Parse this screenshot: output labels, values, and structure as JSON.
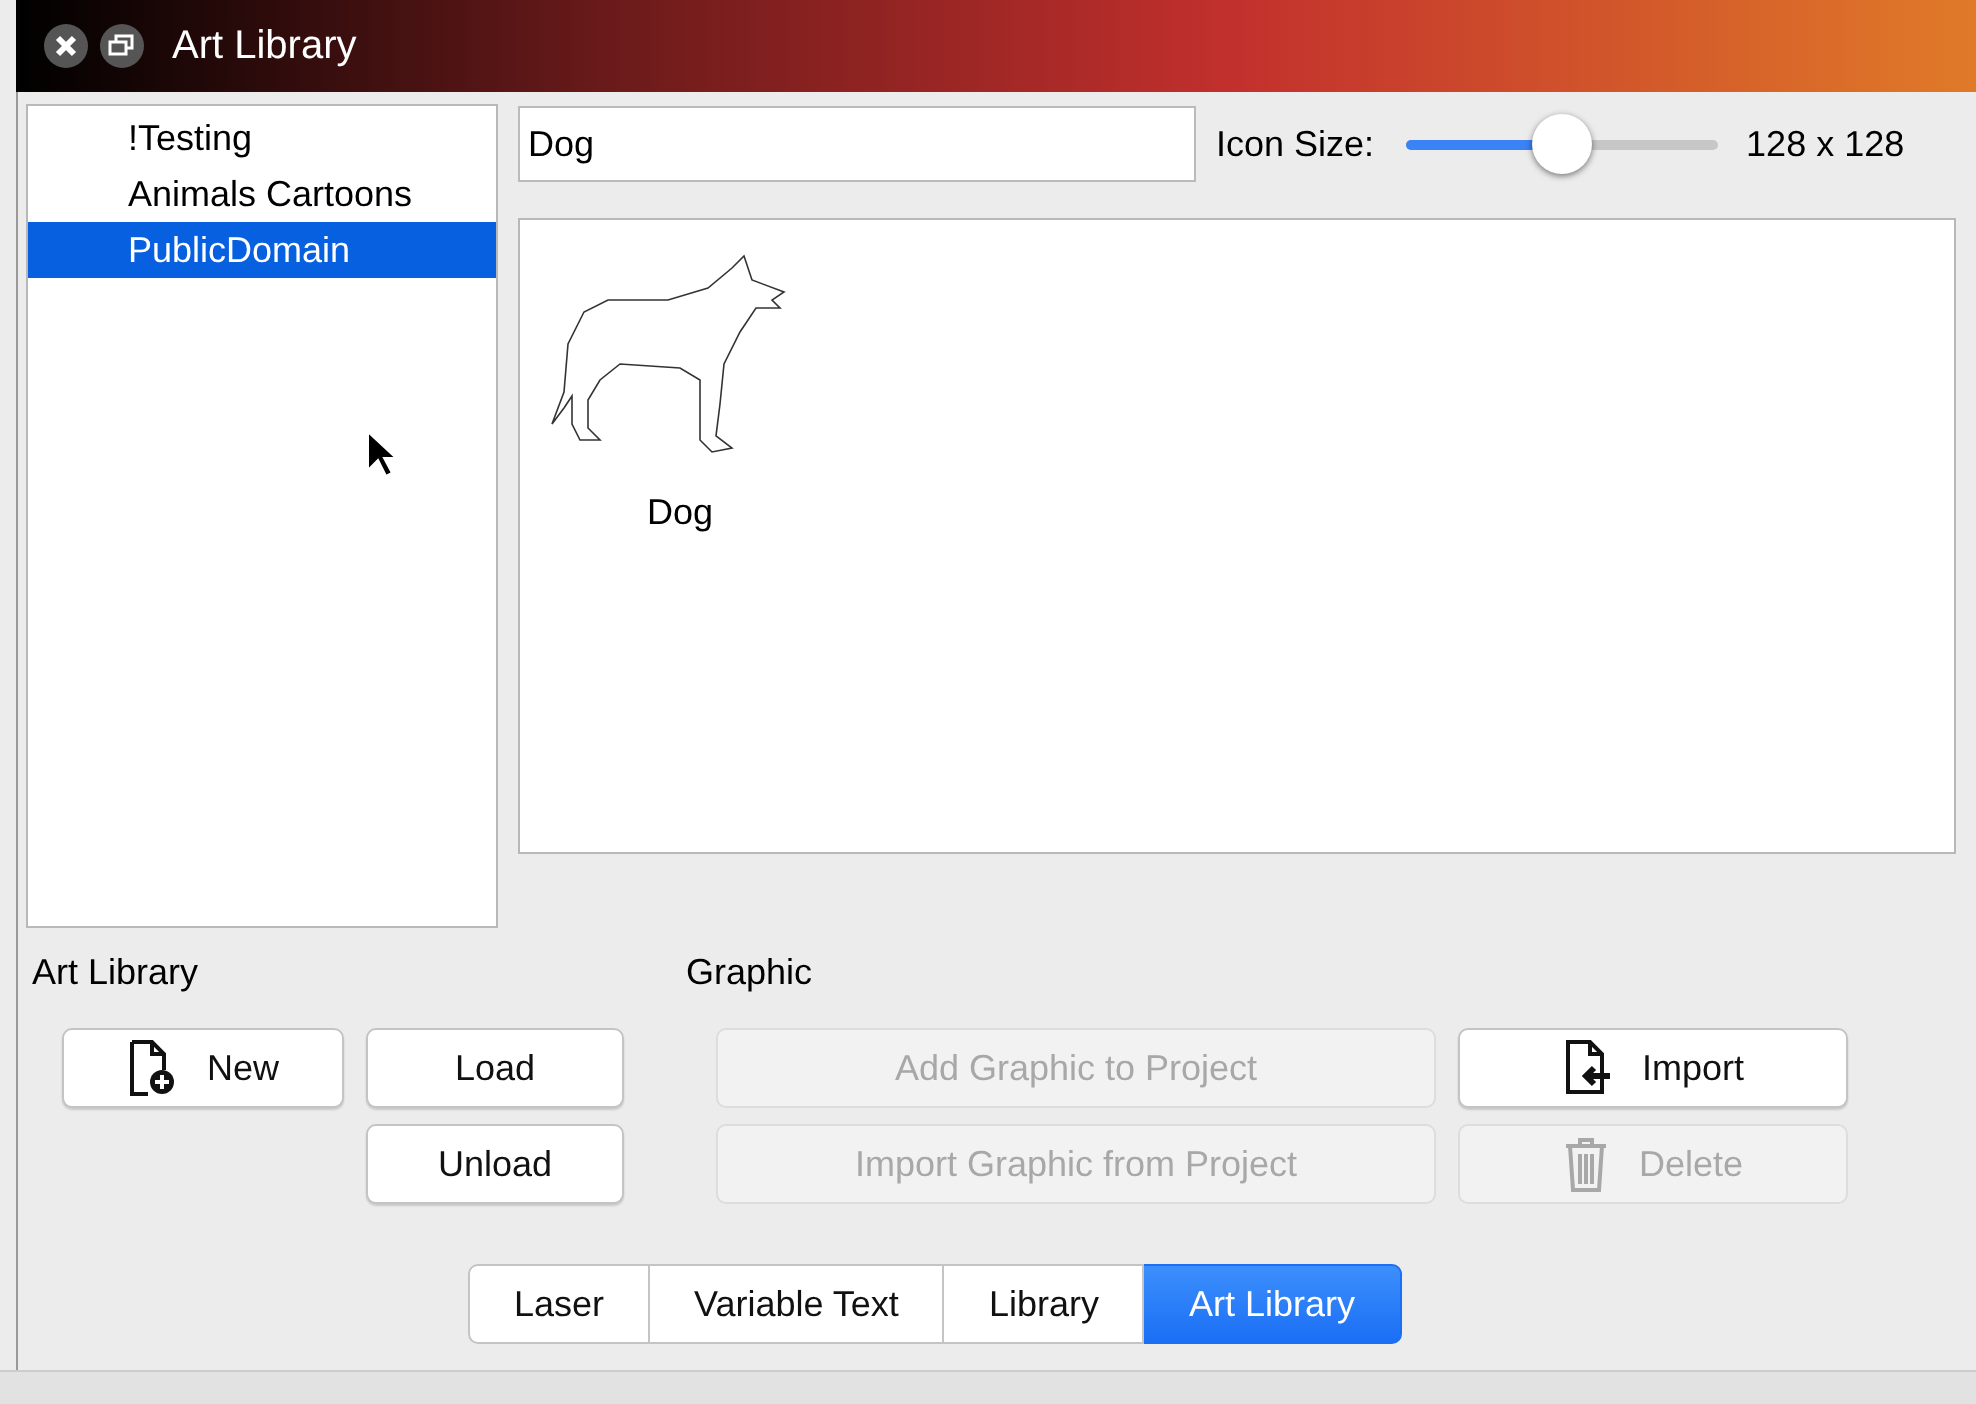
{
  "window": {
    "title": "Art Library"
  },
  "collections": [
    {
      "label": "!Testing",
      "selected": false
    },
    {
      "label": "Animals Cartoons",
      "selected": false
    },
    {
      "label": "PublicDomain",
      "selected": true
    }
  ],
  "search": {
    "value": "Dog"
  },
  "icon_size": {
    "label": "Icon Size:",
    "level": 0.5,
    "reading": "128 x 128"
  },
  "graphics": [
    {
      "name": "Dog",
      "kind": "dog"
    }
  ],
  "art_library": {
    "heading": "Art Library",
    "buttons": [
      {
        "label": "New",
        "kind": "new",
        "disabled": false
      },
      {
        "label": "Load",
        "kind": "plain",
        "disabled": false
      },
      {
        "label": "Unload",
        "kind": "plain",
        "disabled": false
      }
    ]
  },
  "graphic": {
    "heading": "Graphic",
    "buttons": [
      {
        "label": "Add Graphic to Project",
        "kind": "plain",
        "disabled": true
      },
      {
        "label": "Import",
        "kind": "import",
        "disabled": false
      },
      {
        "label": "Import Graphic from Project",
        "kind": "plain",
        "disabled": true
      },
      {
        "label": "Delete",
        "kind": "delete",
        "disabled": true
      }
    ]
  },
  "tabs": [
    {
      "label": "Laser",
      "selected": false
    },
    {
      "label": "Variable Text",
      "selected": false
    },
    {
      "label": "Library",
      "selected": false
    },
    {
      "label": "Art Library",
      "selected": true
    }
  ]
}
